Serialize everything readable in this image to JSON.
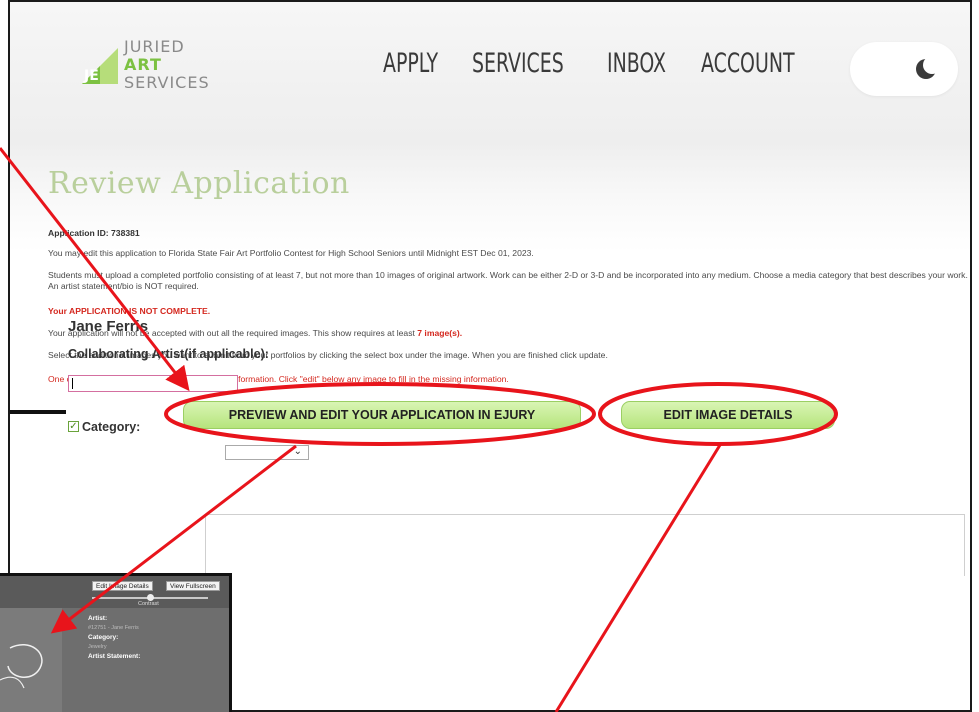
{
  "header": {
    "logo": {
      "line1": "JURIED",
      "line2": "ART",
      "line3": "SERVICES",
      "mark": "JE"
    },
    "nav": [
      "APPLY",
      "SERVICES",
      "INBOX",
      "ACCOUNT"
    ],
    "theme_toggle_icon": "moon-icon"
  },
  "main": {
    "title": "Review Application",
    "application_id_label": "Application ID: 738381",
    "edit_notice": "You may edit this application to Florida State Fair Art Portfolio Contest for High School Seniors until Midnight EST Dec 01, 2023.",
    "requirements": "Students must upload a completed portfolio consisting of at least 7, but not more than 10 images of original artwork. Work can be either 2-D or 3-D and be incorporated into any medium. Choose a media category that best describes your work. An artist statement/bio is NOT required.",
    "incomplete": "Your APPLICATION IS NOT COMPLETE.",
    "required_images_pre": "Your application will not be accepted with out all the required images. This show requires at least ",
    "required_images_count": "7 image(s).",
    "select_instructions": "Select the additional images you want to submit from your portfolios by clicking the select box under the image. When you are finished click update.",
    "missing_info": "One or more of your images is missing required information. Click \"edit\" below any image to fill in the missing information.",
    "preview_button": "PREVIEW AND EDIT YOUR APPLICATION IN EJURY",
    "edit_details_button": "EDIT IMAGE DETAILS",
    "artist_name": "Jane Ferris",
    "collab_label": "Collaborating Artist(if applicable):",
    "collab_value": "",
    "category_label": "Category:"
  },
  "inset": {
    "edit_details_btn": "Edit Image Details",
    "fullscreen_btn": "View Fullscreen",
    "contrast_label": "Contrast",
    "artist_label": "Artist:",
    "artist_value": "#12751 - Jane Ferris",
    "category_label": "Category:",
    "category_value": "Jewelry",
    "statement_label": "Artist Statement:"
  },
  "annotations": {
    "color": "#e8141b"
  }
}
